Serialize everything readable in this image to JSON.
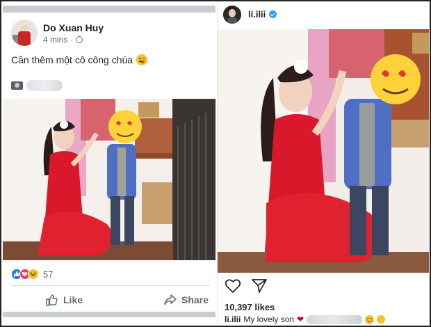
{
  "facebook": {
    "author_name": "Do Xuan Huy",
    "timestamp": "4 mins",
    "post_text": "Cần thêm một cô công chúa",
    "text_emoji_icon": "tongue-wink-emoji-icon",
    "photo_icon": "camera-icon",
    "reaction_count": "57",
    "reaction_icons": [
      "like-reaction-icon",
      "love-reaction-icon",
      "haha-reaction-icon"
    ],
    "like_label": "Like",
    "share_label": "Share",
    "colors": {
      "like_blue": "#1877f2",
      "love_red": "#f33e58",
      "haha_yellow": "#f7c02c",
      "meta_gray": "#65676b"
    }
  },
  "instagram": {
    "username": "li.ilii",
    "verified_icon": "verified-badge-icon",
    "likes_text": "10,397 likes",
    "caption_user": "li.ilii",
    "caption_text": "My lovely son",
    "caption_icons": [
      "red-heart-icon",
      "blushing-emoji-icon",
      "sun-emoji-icon"
    ],
    "action_icons": [
      "heart-outline-icon",
      "send-icon"
    ],
    "colors": {
      "verified_blue": "#3897f0",
      "heart_red": "#d0021b"
    }
  },
  "photo": {
    "description_colors": {
      "dress_red": "#d9182b",
      "suit_blue": "#4f6fc4",
      "face_emoji_yellow": "#ffd23a"
    }
  }
}
